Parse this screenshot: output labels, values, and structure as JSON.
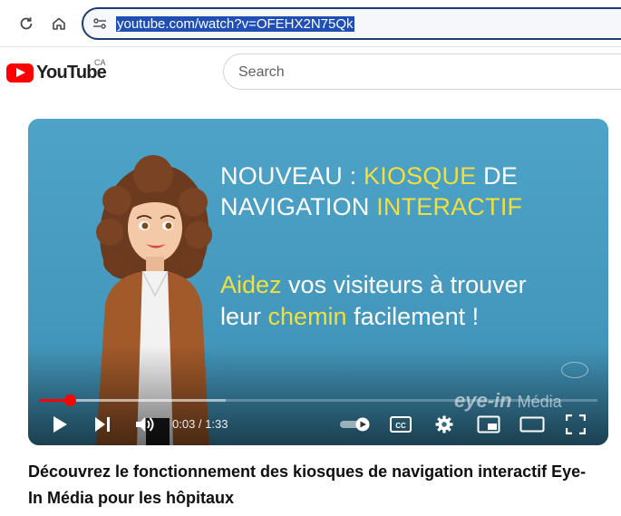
{
  "browser": {
    "url": "youtube.com/watch?v=OFEHX2N75Qk"
  },
  "header": {
    "logo_text": "YouTube",
    "country_code": "CA",
    "search_placeholder": "Search"
  },
  "player": {
    "headline": {
      "part1": "NOUVEAU : ",
      "part2": "KIOSQUE",
      "part3": " DE",
      "part4": "NAVIGATION ",
      "part5": "INTERACTIF"
    },
    "subline": {
      "part1": "Aidez",
      "part2": " vos visiteurs à trouver",
      "part3": "leur ",
      "part4": "chemin",
      "part5": " facilement !"
    },
    "brand_text": "eye-in",
    "brand_suffix": "Média",
    "current_time": "0:03",
    "duration": "1:33",
    "time_separator": " / ",
    "progress_played_fraction": 0.056,
    "progress_buffered_fraction": 0.335,
    "highlight_color": "#f2df3c",
    "progress_color": "#ff0000"
  },
  "video": {
    "title": "Découvrez le fonctionnement des kiosques de navigation interactif Eye-In Média pour les hôpitaux"
  },
  "icons": [
    "reload-icon",
    "home-icon",
    "site-info-icon",
    "youtube-logo-icon",
    "play-icon",
    "next-icon",
    "volume-icon",
    "autoplay-toggle-icon",
    "subtitles-icon",
    "settings-icon",
    "miniplayer-icon",
    "theater-mode-icon",
    "fullscreen-icon"
  ]
}
